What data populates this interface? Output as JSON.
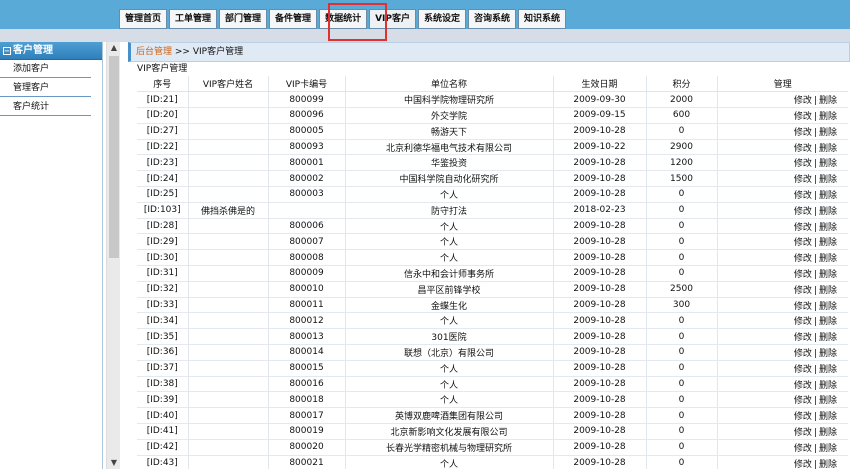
{
  "tabs": [
    {
      "label": "管理首页"
    },
    {
      "label": "工单管理"
    },
    {
      "label": "部门管理"
    },
    {
      "label": "备件管理"
    },
    {
      "label": "数据统计"
    },
    {
      "label": "VIP客户"
    },
    {
      "label": "系统设定"
    },
    {
      "label": "咨询系统"
    },
    {
      "label": "知识系统"
    }
  ],
  "sidebar": {
    "title": "客户管理",
    "items": [
      {
        "label": "添加客户"
      },
      {
        "label": "管理客户"
      },
      {
        "label": "客户统计"
      }
    ]
  },
  "breadcrumb": {
    "home": "后台管理",
    "separator": " >> ",
    "current": "VIP客户管理"
  },
  "section_title": "VIP客户管理",
  "table": {
    "headers": {
      "no": "序号",
      "name": "VIP客户姓名",
      "card": "VIP卡编号",
      "unit": "单位名称",
      "date": "生效日期",
      "points": "积分",
      "manage": "管理"
    },
    "edit_label": "修改",
    "sep_label": "|",
    "delete_label": "删除",
    "rows": [
      {
        "id": "[ID:21]",
        "name": "",
        "card": "800099",
        "unit": "中国科学院物理研究所",
        "date": "2009-09-30",
        "points": "2000"
      },
      {
        "id": "[ID:20]",
        "name": "",
        "card": "800096",
        "unit": "外交学院",
        "date": "2009-09-15",
        "points": "600"
      },
      {
        "id": "[ID:27]",
        "name": "",
        "card": "800005",
        "unit": "畅游天下",
        "date": "2009-10-28",
        "points": "0"
      },
      {
        "id": "[ID:22]",
        "name": "",
        "card": "800093",
        "unit": "北京利德华福电气技术有限公司",
        "date": "2009-10-22",
        "points": "2900"
      },
      {
        "id": "[ID:23]",
        "name": "",
        "card": "800001",
        "unit": "华鉴投资",
        "date": "2009-10-28",
        "points": "1200"
      },
      {
        "id": "[ID:24]",
        "name": "",
        "card": "800002",
        "unit": "中国科学院自动化研究所",
        "date": "2009-10-28",
        "points": "1500"
      },
      {
        "id": "[ID:25]",
        "name": "",
        "card": "800003",
        "unit": "个人",
        "date": "2009-10-28",
        "points": "0"
      },
      {
        "id": "[ID:103]",
        "name": "佛挡杀佛是的",
        "card": "",
        "unit": "防守打法",
        "date": "2018-02-23",
        "points": "0"
      },
      {
        "id": "[ID:28]",
        "name": "",
        "card": "800006",
        "unit": "个人",
        "date": "2009-10-28",
        "points": "0"
      },
      {
        "id": "[ID:29]",
        "name": "",
        "card": "800007",
        "unit": "个人",
        "date": "2009-10-28",
        "points": "0"
      },
      {
        "id": "[ID:30]",
        "name": "",
        "card": "800008",
        "unit": "个人",
        "date": "2009-10-28",
        "points": "0"
      },
      {
        "id": "[ID:31]",
        "name": "",
        "card": "800009",
        "unit": "信永中和会计师事务所",
        "date": "2009-10-28",
        "points": "0"
      },
      {
        "id": "[ID:32]",
        "name": "",
        "card": "800010",
        "unit": "昌平区前锋学校",
        "date": "2009-10-28",
        "points": "2500"
      },
      {
        "id": "[ID:33]",
        "name": "",
        "card": "800011",
        "unit": "金蝶生化",
        "date": "2009-10-28",
        "points": "300"
      },
      {
        "id": "[ID:34]",
        "name": "",
        "card": "800012",
        "unit": "个人",
        "date": "2009-10-28",
        "points": "0"
      },
      {
        "id": "[ID:35]",
        "name": "",
        "card": "800013",
        "unit": "301医院",
        "date": "2009-10-28",
        "points": "0"
      },
      {
        "id": "[ID:36]",
        "name": "",
        "card": "800014",
        "unit": "联想（北京）有限公司",
        "date": "2009-10-28",
        "points": "0"
      },
      {
        "id": "[ID:37]",
        "name": "",
        "card": "800015",
        "unit": "个人",
        "date": "2009-10-28",
        "points": "0"
      },
      {
        "id": "[ID:38]",
        "name": "",
        "card": "800016",
        "unit": "个人",
        "date": "2009-10-28",
        "points": "0"
      },
      {
        "id": "[ID:39]",
        "name": "",
        "card": "800018",
        "unit": "个人",
        "date": "2009-10-28",
        "points": "0"
      },
      {
        "id": "[ID:40]",
        "name": "",
        "card": "800017",
        "unit": "英博双鹿啤酒集团有限公司",
        "date": "2009-10-28",
        "points": "0"
      },
      {
        "id": "[ID:41]",
        "name": "",
        "card": "800019",
        "unit": "北京新影响文化发展有限公司",
        "date": "2009-10-28",
        "points": "0"
      },
      {
        "id": "[ID:42]",
        "name": "",
        "card": "800020",
        "unit": "长春光学精密机械与物理研究所",
        "date": "2009-10-28",
        "points": "0"
      },
      {
        "id": "[ID:43]",
        "name": "",
        "card": "800021",
        "unit": "个人",
        "date": "2009-10-28",
        "points": "0"
      }
    ]
  }
}
